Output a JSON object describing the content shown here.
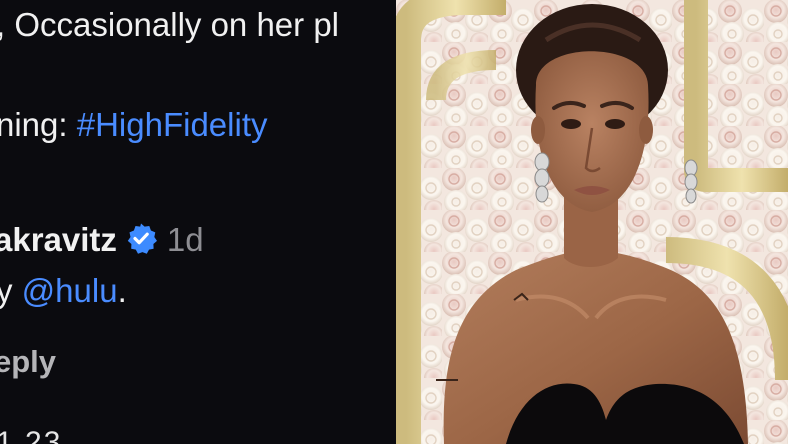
{
  "comments": {
    "line1": ", Occasionally on her pl",
    "line2_prefix": "ning: ",
    "hashtag": "#HighFidelity",
    "username": "akravitz",
    "time": "1d",
    "line4_prefix": "y ",
    "mention": "@hulu",
    "line4_suffix": ".",
    "reply_label": "eply",
    "cut_text": "1 23"
  },
  "icons": {
    "verified": "verified-badge-icon"
  },
  "colors": {
    "background": "#0b0b0f",
    "link": "#4a8cff",
    "verified": "#3d8bff",
    "muted": "#8e8e93"
  }
}
